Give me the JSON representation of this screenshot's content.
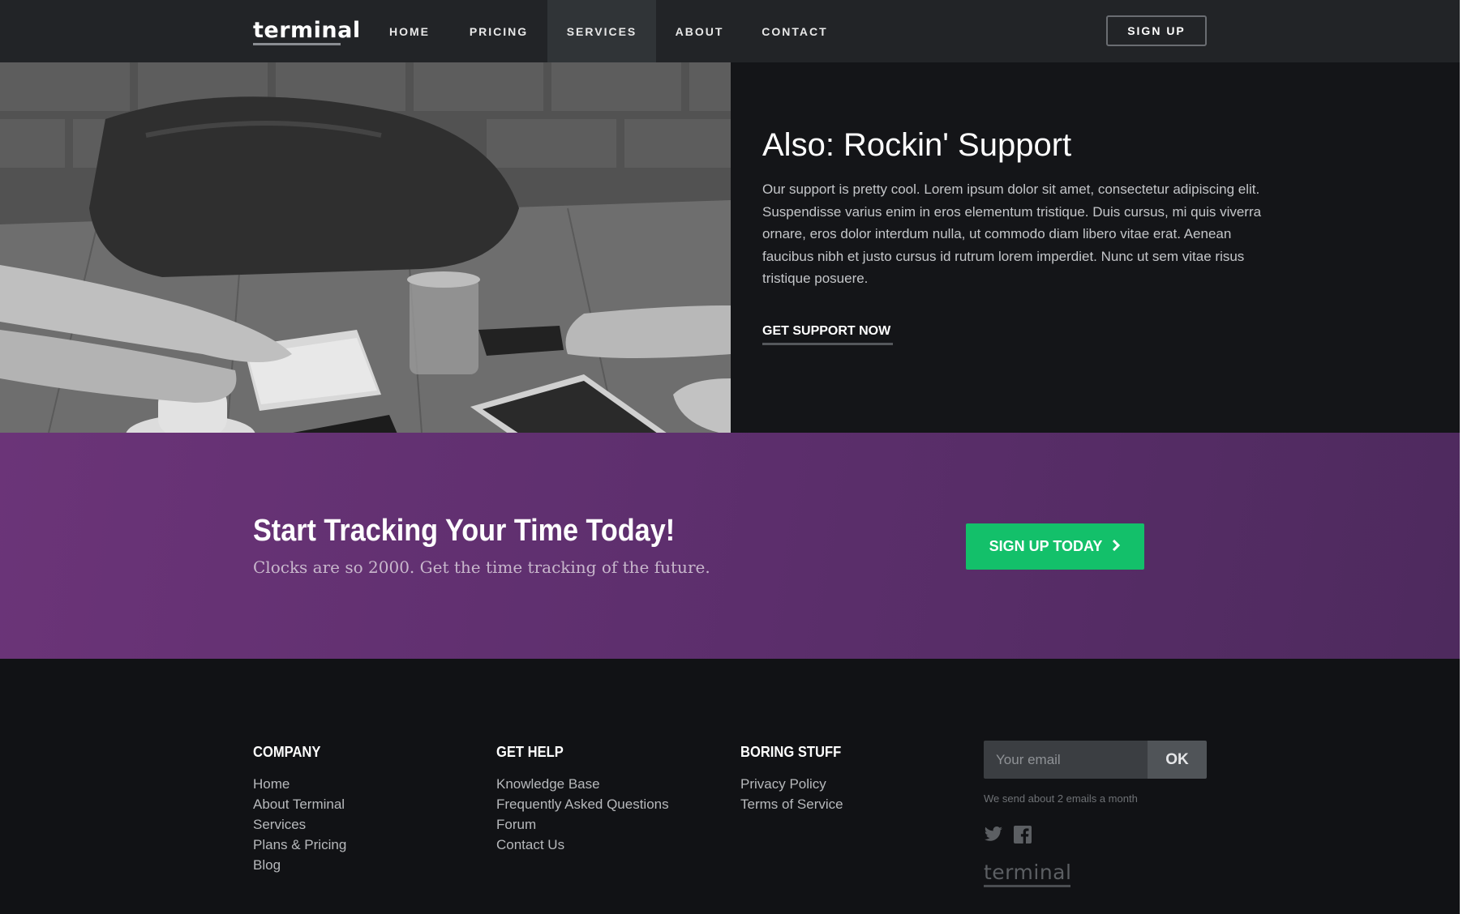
{
  "nav": {
    "logo": "terminal",
    "items": [
      {
        "label": "HOME"
      },
      {
        "label": "PRICING"
      },
      {
        "label": "SERVICES"
      },
      {
        "label": "ABOUT"
      },
      {
        "label": "CONTACT"
      }
    ],
    "active_item": "SERVICES",
    "signup_label": "SIGN UP"
  },
  "support": {
    "title": "Also: Rockin' Support",
    "body": "Our support is pretty cool. Lorem ipsum dolor sit amet, consectetur adipiscing elit. Suspendisse varius enim in eros elementum tristique. Duis cursus, mi quis viverra ornare, eros dolor interdum nulla, ut commodo diam libero vitae erat. Aenean faucibus nibh et justo cursus id rutrum lorem imperdiet. Nunc ut sem vitae risus tristique posuere.",
    "link_label": "GET SUPPORT NOW"
  },
  "cta": {
    "title": "Start Tracking Your Time Today!",
    "subtitle": "Clocks are so 2000. Get the time tracking of the future.",
    "button_label": "SIGN UP TODAY",
    "button_icon": "chevron-right-icon",
    "button_color": "#13c06a",
    "background_color": "#5e2f6e"
  },
  "footer": {
    "columns": [
      {
        "heading": "COMPANY",
        "links": [
          "Home",
          "About Terminal",
          "Services",
          "Plans & Pricing",
          "Blog"
        ]
      },
      {
        "heading": "GET HELP",
        "links": [
          "Knowledge Base",
          "Frequently Asked Questions",
          "Forum",
          "Contact Us"
        ]
      },
      {
        "heading": "BORING STUFF",
        "links": [
          "Privacy Policy",
          "Terms of Service"
        ]
      }
    ],
    "newsletter": {
      "placeholder": "Your email",
      "button_label": "OK",
      "note": "We send about 2 emails a month"
    },
    "social_icons": [
      "twitter-icon",
      "facebook-icon"
    ],
    "logo": "terminal"
  }
}
